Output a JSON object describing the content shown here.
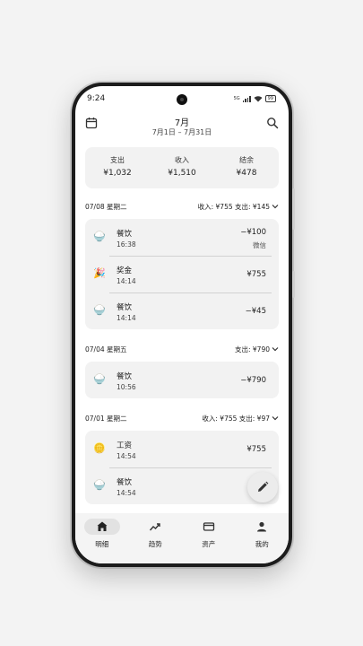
{
  "status_bar": {
    "time": "9:24",
    "network": "5G",
    "battery": "99"
  },
  "header": {
    "title": "7月",
    "subtitle": "7月1日 – 7月31日"
  },
  "summary": [
    {
      "label": "支出",
      "value": "¥1,032"
    },
    {
      "label": "收入",
      "value": "¥1,510"
    },
    {
      "label": "结余",
      "value": "¥478"
    }
  ],
  "days": [
    {
      "date": "07/08 星期二",
      "summary": "收入: ¥755 支出: ¥145",
      "items": [
        {
          "icon": "rice-bowl-icon",
          "name": "餐饮",
          "time": "16:38",
          "amount": "−¥100",
          "note": "微信"
        },
        {
          "icon": "party-popper-icon",
          "name": "奖金",
          "time": "14:14",
          "amount": "¥755"
        },
        {
          "icon": "rice-bowl-icon",
          "name": "餐饮",
          "time": "14:14",
          "amount": "−¥45"
        }
      ]
    },
    {
      "date": "07/04 星期五",
      "summary": "支出: ¥790",
      "items": [
        {
          "icon": "rice-bowl-icon",
          "name": "餐饮",
          "time": "10:56",
          "amount": "−¥790"
        }
      ]
    },
    {
      "date": "07/01 星期二",
      "summary": "收入: ¥755 支出: ¥97",
      "items": [
        {
          "icon": "coin-icon",
          "name": "工资",
          "time": "14:54",
          "amount": "¥755"
        },
        {
          "icon": "rice-bowl-icon",
          "name": "餐饮",
          "time": "14:54",
          "amount": "−"
        }
      ]
    }
  ],
  "nav": [
    {
      "label": "明细",
      "icon": "home-icon",
      "active": true
    },
    {
      "label": "趋势",
      "icon": "trend-icon",
      "active": false
    },
    {
      "label": "资产",
      "icon": "card-icon",
      "active": false
    },
    {
      "label": "我的",
      "icon": "person-icon",
      "active": false
    }
  ]
}
